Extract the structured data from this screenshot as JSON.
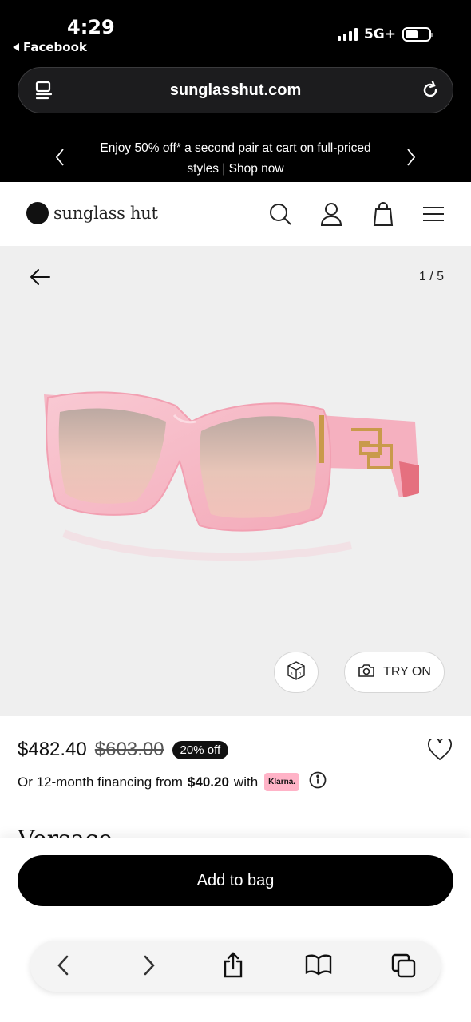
{
  "status_bar": {
    "time": "4:29",
    "back_app": "Facebook",
    "network": "5G+"
  },
  "browser": {
    "url": "sunglasshut.com"
  },
  "promo": {
    "text": "Enjoy 50% off* a second pair at cart on full-priced styles | Shop now"
  },
  "site": {
    "logo_text": "sunglass hut",
    "icons": [
      "search-icon",
      "account-icon",
      "bag-icon",
      "menu-icon"
    ]
  },
  "gallery": {
    "counter": "1 / 5",
    "try_on_label": "TRY ON",
    "background": "#efefef"
  },
  "product": {
    "price": "$482.40",
    "original_price": "$603.00",
    "discount_badge": "20% off",
    "financing_prefix": "Or 12-month financing from",
    "financing_amount": "$40.20",
    "financing_suffix": "with",
    "klarna_label": "Klarna.",
    "brand": "Versace"
  },
  "cta": {
    "add_to_bag": "Add to bag"
  },
  "safari_toolbar": {
    "buttons": [
      "back-icon",
      "forward-icon",
      "share-icon",
      "bookmarks-icon",
      "tabs-icon"
    ]
  },
  "colors": {
    "frame_pink": "#f6b9c6",
    "lens": "#e7b8a8",
    "klarna_pink": "#ffb3c7",
    "black": "#000000"
  }
}
